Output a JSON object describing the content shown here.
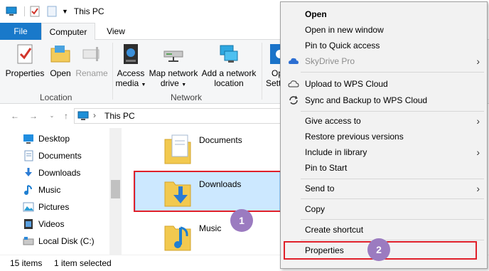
{
  "window": {
    "title": "This PC"
  },
  "ribbon": {
    "tabs": [
      "File",
      "Computer",
      "View"
    ],
    "location_group": {
      "label": "Location",
      "buttons": [
        {
          "label": "Properties",
          "icon": "properties-icon",
          "enabled": true
        },
        {
          "label": "Open",
          "icon": "open-icon",
          "enabled": true
        },
        {
          "label": "Rename",
          "icon": "rename-icon",
          "enabled": false
        }
      ]
    },
    "network_group": {
      "label": "Network",
      "buttons": [
        {
          "line1": "Access",
          "line2": "media",
          "icon": "access-media-icon",
          "dropdown": true
        },
        {
          "line1": "Map network",
          "line2": "drive",
          "icon": "map-network-drive-icon",
          "dropdown": true
        },
        {
          "line1": "Add a network",
          "line2": "location",
          "icon": "add-network-location-icon",
          "dropdown": false
        }
      ]
    },
    "system_group": {
      "line1": "Op",
      "line2": "Sett"
    }
  },
  "address": {
    "path": "This PC"
  },
  "nav_pane": {
    "items": [
      {
        "label": "Desktop",
        "icon": "desktop-icon"
      },
      {
        "label": "Documents",
        "icon": "documents-icon"
      },
      {
        "label": "Downloads",
        "icon": "downloads-icon"
      },
      {
        "label": "Music",
        "icon": "music-icon"
      },
      {
        "label": "Pictures",
        "icon": "pictures-icon"
      },
      {
        "label": "Videos",
        "icon": "videos-icon"
      },
      {
        "label": "Local Disk (C:)",
        "icon": "local-disk-icon"
      }
    ]
  },
  "content": {
    "folders": [
      {
        "label": "Documents",
        "icon": "documents-folder-icon"
      },
      {
        "label": "Downloads",
        "icon": "downloads-folder-icon",
        "selected": true
      },
      {
        "label": "Music",
        "icon": "music-folder-icon"
      }
    ]
  },
  "status": {
    "item_count": "15 items",
    "selection": "1 item selected"
  },
  "context_menu": {
    "items": [
      {
        "label": "Open",
        "bold": true
      },
      {
        "label": "Open in new window"
      },
      {
        "label": "Pin to Quick access"
      },
      {
        "label": "SkyDrive Pro",
        "disabled": true,
        "submenu": true,
        "icon": "skydrive-icon"
      },
      {
        "label": "Upload to WPS Cloud",
        "icon": "cloud-upload-icon"
      },
      {
        "label": "Sync and Backup to WPS Cloud",
        "icon": "sync-icon"
      },
      {
        "label": "Give access to",
        "submenu": true
      },
      {
        "label": "Restore previous versions"
      },
      {
        "label": "Include in library",
        "submenu": true
      },
      {
        "label": "Pin to Start"
      },
      {
        "label": "Send to",
        "submenu": true
      },
      {
        "label": "Copy"
      },
      {
        "label": "Create shortcut"
      },
      {
        "label": "Properties",
        "highlighted": true
      }
    ]
  },
  "annotations": {
    "step1": "1",
    "step2": "2"
  },
  "colors": {
    "accent": "#1979ca",
    "selection": "#cce8ff",
    "highlight": "#e0202a",
    "badge": "#9b7bc0"
  }
}
